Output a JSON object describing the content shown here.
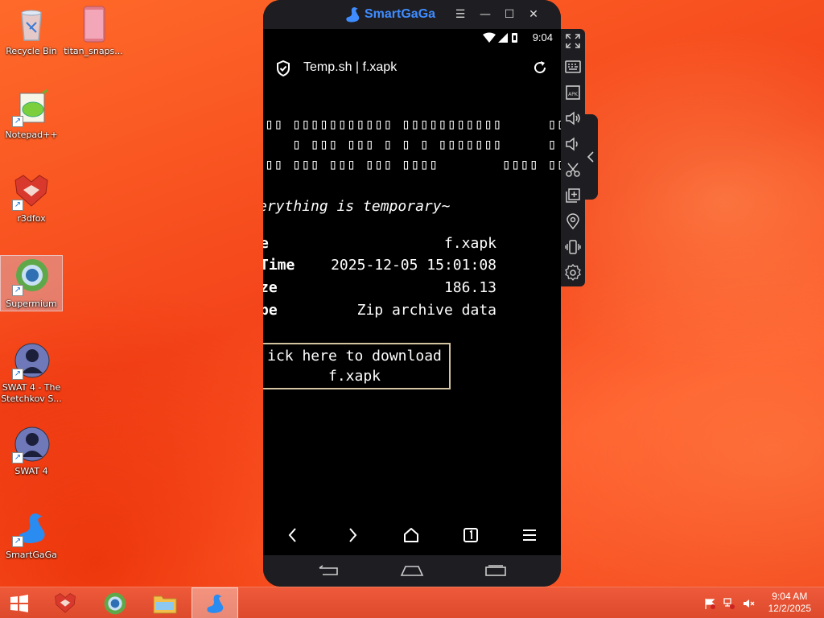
{
  "desktop": {
    "icons": [
      {
        "label": "Recycle Bin"
      },
      {
        "label": "titan_snaps..."
      },
      {
        "label": "Notepad++"
      },
      {
        "label": "r3dfox"
      },
      {
        "label": "Supermium"
      },
      {
        "label": "SWAT 4 - The Stetchkov S..."
      },
      {
        "label": "SWAT 4"
      },
      {
        "label": "SmartGaGa"
      }
    ]
  },
  "emulator": {
    "app_name": "SmartGaGa",
    "status_time": "9:04",
    "tab_title": "Temp.sh | f.xapk",
    "ascii_banner": [
      "▯▯ ▯▯▯▯▯▯▯▯▯▯▯ ▯▯▯▯▯▯▯▯▯▯▯     ▯▯",
      "   ▯ ▯▯▯ ▯▯▯ ▯ ▯ ▯ ▯▯▯▯▯▯▯     ▯",
      "▯▯ ▯▯▯ ▯▯▯ ▯▯▯ ▯▯▯▯       ▯▯▯▯ ▯▯"
    ],
    "tagline": "erything is temporary~",
    "file_info": [
      {
        "key": "e",
        "value": "f.xapk"
      },
      {
        "key": "Time",
        "value": "2025-12-05 15:01:08"
      },
      {
        "key": "ze",
        "value": "186.13"
      },
      {
        "key": "pe",
        "value": "Zip archive data"
      }
    ],
    "download_line1": "ick here to download",
    "download_line2": "f.xapk"
  },
  "taskbar": {
    "time": "9:04 AM",
    "date": "12/2/2025"
  }
}
